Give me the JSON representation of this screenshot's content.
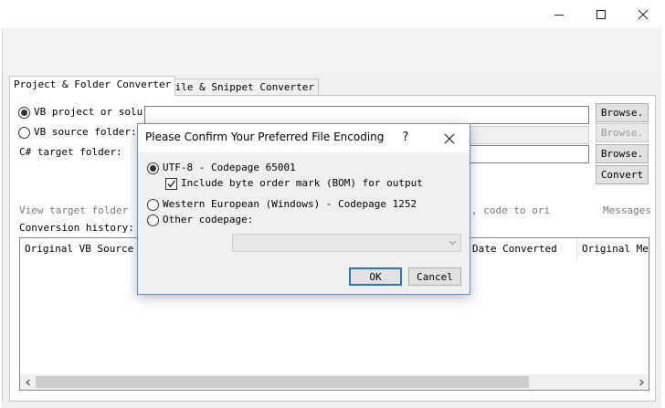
{
  "window": {
    "controls": {
      "minimize": "minimize-icon",
      "maximize": "maximize-icon",
      "close": "close-icon"
    }
  },
  "tabs": [
    {
      "label": "Project & Folder Converter",
      "selected": true
    },
    {
      "label": "File & Snippet Converter",
      "selected": false
    }
  ],
  "form": {
    "vb_project_label": "VB project or solu",
    "vb_source_label": "VB source folder:",
    "csharp_target_label": "C# target folder:",
    "browse_label": "Browse.",
    "convert_label": "Convert",
    "view_target_label": "View target folder",
    "code_to_ori_label": ", code to ori",
    "messages_label": "Messages",
    "history_label": "Conversion history:",
    "vb_project_selected": true
  },
  "history_table": {
    "columns": [
      "Original VB Source",
      "Date Converted",
      "Original Mes"
    ],
    "rows": []
  },
  "dialog": {
    "title": "Please Confirm Your Preferred File Encoding",
    "help_label": "?",
    "options": {
      "utf8": "UTF-8 - Codepage 65001",
      "bom": "Include byte order mark (BOM) for output",
      "western": "Western European (Windows) - Codepage 1252",
      "other": "Other codepage:"
    },
    "selected_option": "utf8",
    "bom_checked": true,
    "codepage_selected": "",
    "ok_label": "OK",
    "cancel_label": "Cancel"
  },
  "colors": {
    "dialog_border": "#6b8fb5",
    "default_button_border": "#2b74c7",
    "panel_bg": "#f0f0f0"
  }
}
